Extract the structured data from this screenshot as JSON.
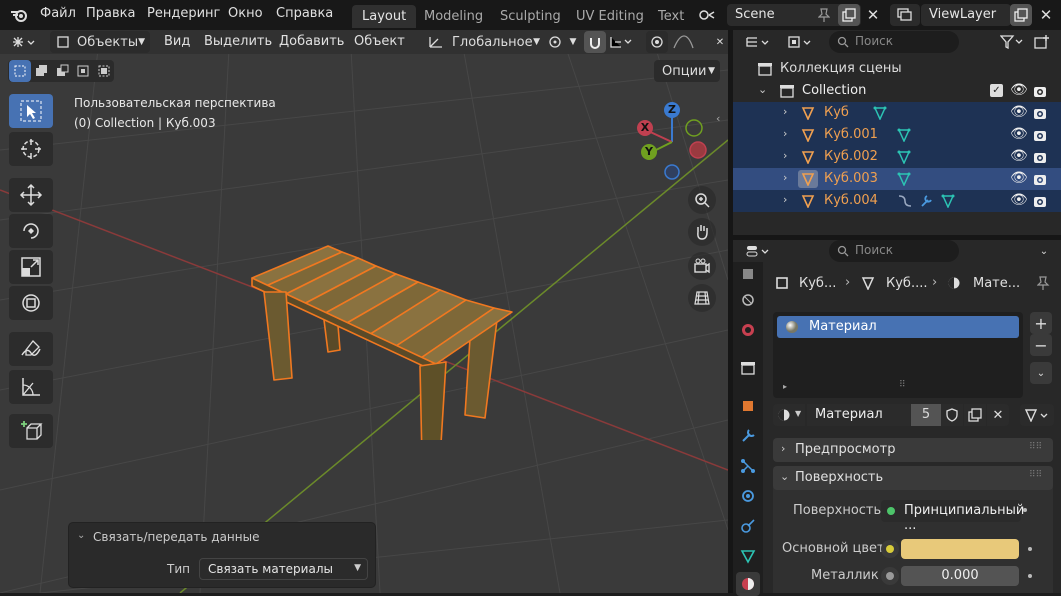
{
  "topbar": {
    "menu": [
      "Файл",
      "Правка",
      "Рендеринг",
      "Окно",
      "Справка"
    ],
    "workspaces": [
      "Layout",
      "Modeling",
      "Sculpting",
      "UV Editing",
      "Text"
    ],
    "active_workspace": "Layout",
    "scene": "Scene",
    "view_layer": "ViewLayer"
  },
  "viewport_header": {
    "mode": "Объекты",
    "menus": [
      "Вид",
      "Выделить",
      "Добавить",
      "Объект"
    ],
    "orientation": "Глобальное",
    "options": "Опции"
  },
  "viewport": {
    "perspective_label": "Пользовательская перспектива",
    "context_label": "(0) Collection | Куб.003",
    "gizmo_axes": {
      "x": "X",
      "y": "Y",
      "z": "Z"
    }
  },
  "last_op_panel": {
    "title": "Связать/передать данные",
    "type_label": "Тип",
    "type_value": "Связать материалы"
  },
  "outliner": {
    "search_placeholder": "Поиск",
    "root": "Коллекция сцены",
    "collection": "Collection",
    "objects": [
      "Куб",
      "Куб.001",
      "Куб.002",
      "Куб.003",
      "Куб.004"
    ],
    "selected_index": 3
  },
  "properties": {
    "search_placeholder": "Поиск",
    "breadcrumb": [
      "Куб...",
      "Куб....",
      "Мате..."
    ],
    "slot_name": "Материал",
    "material_name": "Материал",
    "users": "5",
    "panels": {
      "preview": "Предпросмотр",
      "surface": "Поверхность"
    },
    "surface_label": "Поверхность",
    "surface_value": "Принципиальный ...",
    "base_color_label": "Основной цвет",
    "base_color": "#e8c97a",
    "metallic_label": "Металлик",
    "metallic_value": "0.000"
  },
  "colors": {
    "accent": "#4772b3",
    "selection": "#f08030",
    "object_name": "#f0a050"
  }
}
